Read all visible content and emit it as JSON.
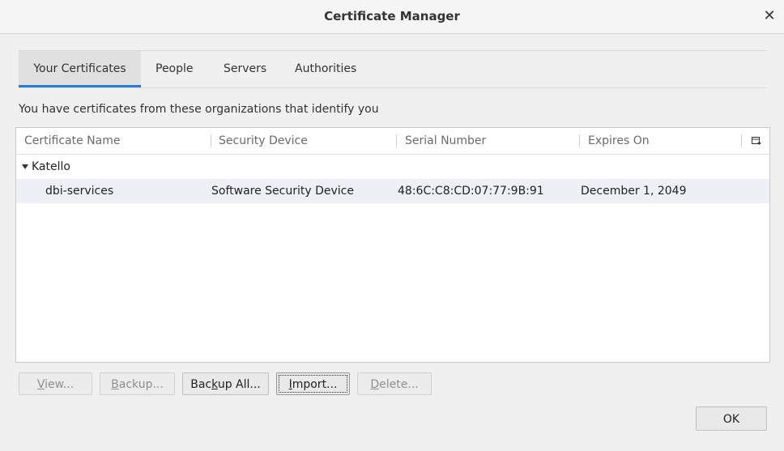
{
  "window": {
    "title": "Certificate Manager",
    "close_glyph": "✕"
  },
  "tabs": [
    {
      "label": "Your Certificates",
      "active": true
    },
    {
      "label": "People",
      "active": false
    },
    {
      "label": "Servers",
      "active": false
    },
    {
      "label": "Authorities",
      "active": false
    }
  ],
  "description": "You have certificates from these organizations that identify you",
  "table": {
    "columns": [
      "Certificate Name",
      "Security Device",
      "Serial Number",
      "Expires On"
    ],
    "groups": [
      {
        "name": "Katello",
        "expanded": true,
        "rows": [
          {
            "name": "dbi-services",
            "device": "Software Security Device",
            "serial": "48:6C:C8:CD:07:77:9B:91",
            "expires": "December 1, 2049"
          }
        ]
      }
    ]
  },
  "buttons": {
    "view": {
      "pre": "",
      "key": "V",
      "post": "iew..."
    },
    "backup": {
      "pre": "",
      "key": "B",
      "post": "ackup..."
    },
    "backup_all": {
      "pre": "Bac",
      "key": "k",
      "post": "up All..."
    },
    "import": {
      "pre": "",
      "key": "I",
      "post": "mport..."
    },
    "delete": {
      "pre": "",
      "key": "D",
      "post": "elete..."
    },
    "ok": "OK"
  },
  "colors": {
    "accent": "#2a7bd3",
    "selected_row": "#eef0f5"
  }
}
